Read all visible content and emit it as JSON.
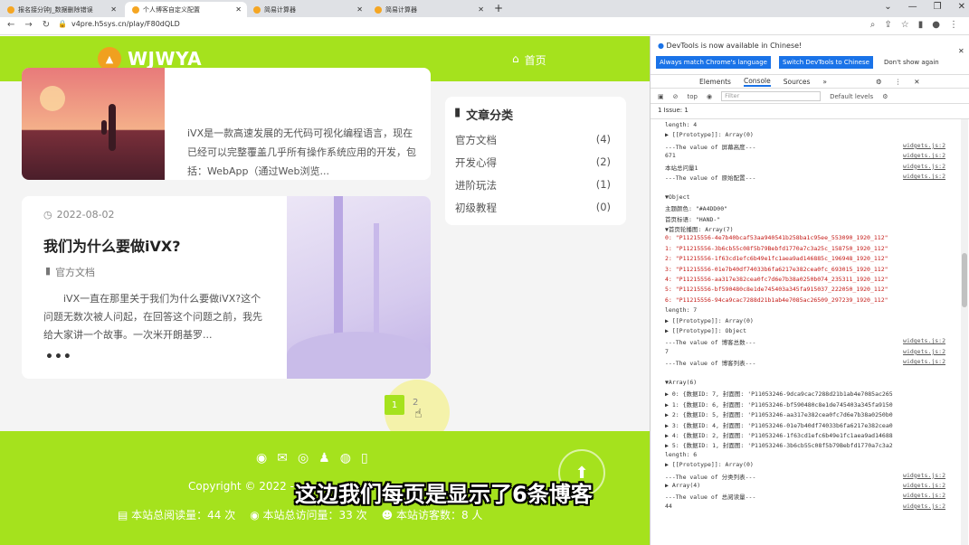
{
  "browser": {
    "tabs": [
      {
        "label": "报名接分钟J_数据删除错误"
      },
      {
        "label": "个人博客自定义配置"
      },
      {
        "label": "简易计算器"
      },
      {
        "label": "简易计算器"
      }
    ],
    "url": "v4pre.h5sys.cn/play/F80dQLD"
  },
  "site": {
    "brand": "WJWYA",
    "home_label": "首页",
    "card1": {
      "excerpt": "iVX是一款高速发展的无代码可视化编程语言，现在已经可以完整覆盖几乎所有操作系统应用的开发，包括：WebApp（通过Web浏览..."
    },
    "card2": {
      "date": "2022-08-02",
      "title": "我们为什么要做iVX?",
      "category": "官方文档",
      "excerpt": "iVX一直在那里关于我们为什么要做iVX?这个问题无数次被人问起，在回答这个问题之前，我先给大家讲一个故事。一次米开朗基罗..."
    },
    "sidebar": {
      "title": "文章分类",
      "items": [
        {
          "name": "官方文档",
          "count": "(4)"
        },
        {
          "name": "开发心得",
          "count": "(2)"
        },
        {
          "name": "进阶玩法",
          "count": "(1)"
        },
        {
          "name": "初级教程",
          "count": "(0)"
        }
      ]
    },
    "pager": {
      "p1": "1",
      "p2": "2"
    },
    "footer": {
      "copyright": "Copyright © 2022 -",
      "stat1": "本站总阅读量：44 次",
      "stat2": "本站总访问量：33 次",
      "stat3": "本站访客数：8 人"
    },
    "subtitle": "这边我们每页是显示了6条博客"
  },
  "devtools": {
    "info": "DevTools is now available in Chinese!",
    "btn1": "Always match Chrome's language",
    "btn2": "Switch DevTools to Chinese",
    "btn3": "Don't show again",
    "tabs": [
      "Elements",
      "Console",
      "Sources"
    ],
    "top": "top",
    "filter_placeholder": "Filter",
    "levels": "Default levels",
    "issues": "1 Issue: 1",
    "lines": [
      {
        "t": "length: 4",
        "s": ""
      },
      {
        "t": "▶ [[Prototype]]: Array(0)",
        "s": ""
      },
      {
        "t": "---The value of 屏幕高度---",
        "s": "widgets.js:2"
      },
      {
        "t": "671",
        "s": "widgets.js:2"
      },
      {
        "t": "本站总问量1",
        "s": "widgets.js:2"
      },
      {
        "t": "---The value of 原始配置---",
        "s": "widgets.js:2"
      },
      {
        "t": "",
        "s": "widgets.js:2"
      },
      {
        "t": "▼Object",
        "s": ""
      },
      {
        "t": "  主题颜色: \"#A4DD00\"",
        "s": ""
      },
      {
        "t": "  首页标语: \"HAND-\"",
        "s": ""
      },
      {
        "t": "  ▼首页轮播图: Array(7)",
        "s": ""
      },
      {
        "t": "    0: \"P11215556-4e7b40bcaf53aa940541b258ba1c95ee_553090_1920_112\"",
        "s": ""
      },
      {
        "t": "    1: \"P11215556-3b6cb55c08f5b79Bebfd1770a7c3a25c_158750_1920_112\"",
        "s": ""
      },
      {
        "t": "    2: \"P11215556-1f63cd1efc6b49e1fc1aea9ad146885c_196948_1920_112\"",
        "s": ""
      },
      {
        "t": "    3: \"P11215556-01e7b40df74033b6fa6217e382cea0fc_693015_1920_112\"",
        "s": ""
      },
      {
        "t": "    4: \"P11215556-aa317e382cea0fc7d6e7b38a0250b074_235311_1920_112\"",
        "s": ""
      },
      {
        "t": "    5: \"P11215556-bf590480c8e1de745403a345fa915037_222050_1920_112\"",
        "s": ""
      },
      {
        "t": "    6: \"P11215556-94ca9cac7288d21b1ab4e7085ac26509_297239_1920_112\"",
        "s": ""
      },
      {
        "t": "    length: 7",
        "s": ""
      },
      {
        "t": "  ▶ [[Prototype]]: Array(0)",
        "s": ""
      },
      {
        "t": "▶ [[Prototype]]: Object",
        "s": ""
      },
      {
        "t": "---The value of 博客总数---",
        "s": "widgets.js:2"
      },
      {
        "t": "7",
        "s": "widgets.js:2"
      },
      {
        "t": "---The value of 博客列表---",
        "s": "widgets.js:2"
      },
      {
        "t": "",
        "s": "widgets.js:2"
      },
      {
        "t": "▼Array(6)",
        "s": ""
      },
      {
        "t": "  ▶ 0: {数据ID: 7, 封面图: 'P11053246-9dca9cac7288d21b1ab4e7085ac265",
        "s": ""
      },
      {
        "t": "  ▶ 1: {数据ID: 6, 封面图: 'P11053246-bf590480c8e1de745403a345fa9150",
        "s": ""
      },
      {
        "t": "  ▶ 2: {数据ID: 5, 封面图: 'P11053246-aa317e382cea0fc7d6e7b38a0250b0",
        "s": ""
      },
      {
        "t": "  ▶ 3: {数据ID: 4, 封面图: 'P11053246-01e7b40df74033b6fa6217e382cea0",
        "s": ""
      },
      {
        "t": "  ▶ 4: {数据ID: 2, 封面图: 'P11053246-1f63cd1efc6b49e1fc1aea9ad14688",
        "s": ""
      },
      {
        "t": "  ▶ 5: {数据ID: 1, 封面图: 'P11053246-3b6cb55c08f5b79Bebfd1770a7c3a2",
        "s": ""
      },
      {
        "t": "    length: 6",
        "s": ""
      },
      {
        "t": "  ▶ [[Prototype]]: Array(0)",
        "s": ""
      },
      {
        "t": "---The value of 分类列表---",
        "s": "widgets.js:2"
      },
      {
        "t": "▶ Array(4)",
        "s": "widgets.js:2"
      },
      {
        "t": "---The value of 总阅读量---",
        "s": "widgets.js:2"
      },
      {
        "t": "44",
        "s": "widgets.js:2"
      }
    ]
  }
}
